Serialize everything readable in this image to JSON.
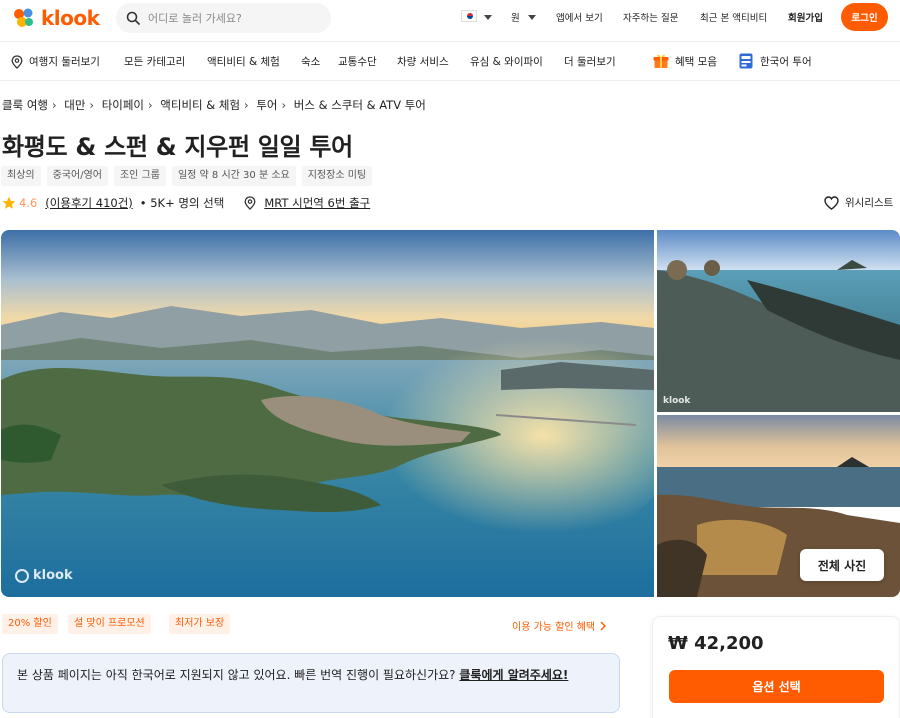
{
  "header": {
    "brand": "klook",
    "search_placeholder": "어디로 놀러 가세요?",
    "currency": "원",
    "links": [
      "앱에서 보기",
      "자주하는 질문",
      "최근 본 액티비티",
      "회원가입"
    ],
    "login": "로그인"
  },
  "categories": [
    "여행지 둘러보기",
    "모든 카테고리",
    "액티비티 & 체험",
    "숙소",
    "교통수단",
    "차량 서비스",
    "유심 & 와이파이",
    "더 둘러보기",
    "혜택 모음",
    "한국어 투어"
  ],
  "breadcrumb": [
    "클룩 여행",
    "대만",
    "타이페이",
    "액티비티 & 체험",
    "투어",
    "버스 & 스쿠터 & ATV 투어"
  ],
  "product": {
    "title": "화평도 & 스펀 & 지우펀 일일 투어",
    "tags": [
      "최상의",
      "중국어/영어",
      "조인 그룹",
      "일정 약 8 시간 30 분 소요",
      "지정장소 미팅"
    ],
    "rating": "4.6",
    "reviews": "(이용후기 410건)",
    "booked": "• 5K+ 명의 선택",
    "meeting_point": "MRT 시먼역 6번 출구",
    "wishlist": "위시리스트"
  },
  "gallery": {
    "watermark": "klook",
    "all_photos": "전체 사진"
  },
  "promos": [
    "20% 할인",
    "설 맞이 프로모션",
    "최저가 보장"
  ],
  "promo_link": "이용 가능 할인 혜택",
  "notice": {
    "text": "본 상품 페이지는 아직 한국어로 지원되지 않고 있어요. 빠른 번역 진행이 필요하신가요? ",
    "link": "클룩에게 알려주세요!"
  },
  "price": {
    "amount": "₩ 42,200",
    "button": "옵션 선택"
  },
  "colors": {
    "brand": "#ff5b00",
    "rating": "#ff9557",
    "notice_bg": "#eef3fb"
  }
}
